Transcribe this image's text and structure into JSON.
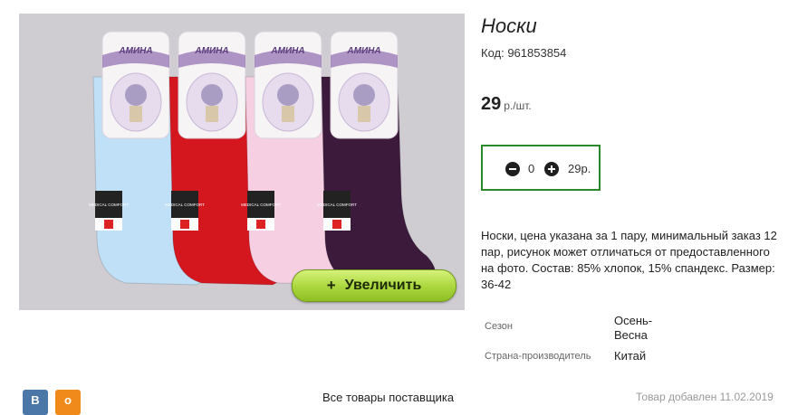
{
  "product": {
    "title": "Носки",
    "code": "Код: 961853854",
    "price_value": "29",
    "price_unit": "р./шт.",
    "zoom_label": "Увеличить",
    "zoom_plus": "+",
    "image_brand": "АМИНА",
    "image_tag": "MEDICAL COMFORT",
    "sock_colors": [
      "#bfe0f6",
      "#d4161e",
      "#f6cfe3",
      "#3b1a3c"
    ]
  },
  "quantity": {
    "count": "0",
    "sum": "29р."
  },
  "description": "Носки, цена указана за 1 пару, минимальный заказ 12 пар, рисунок может отличаться от предоставленного на фото. Состав: 85% хлопок, 15% спандекс. Размер: 36-42",
  "properties": [
    {
      "label": "Сезон",
      "value": "Осень-Весна"
    },
    {
      "label": "Страна-производитель",
      "value": "Китай"
    }
  ],
  "footer": {
    "vk_label": "В",
    "ok_label": "о",
    "link_text": "Все товары поставщика",
    "note_text": "Товар добавлен 11.02.2019"
  }
}
